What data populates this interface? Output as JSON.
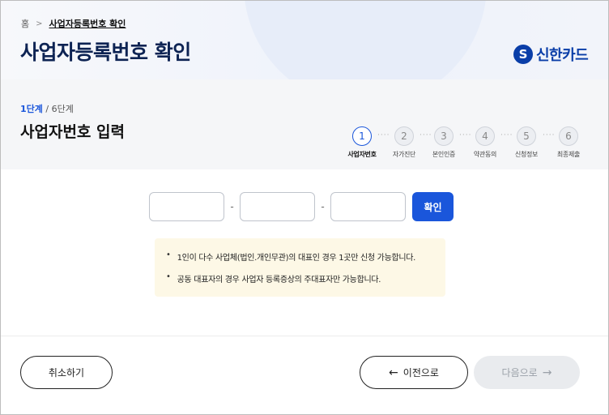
{
  "breadcrumb": {
    "home": "홈",
    "current": "사업자등록번호 확인"
  },
  "page_title": "사업자등록번호 확인",
  "brand": {
    "logo_glyph": "S",
    "name": "신한카드",
    "color": "#0a3ea8"
  },
  "step_count": {
    "current": "1단계",
    "total": " / 6단계"
  },
  "step_heading": "사업자번호 입력",
  "steps": [
    {
      "num": "1",
      "label": "사업자번호",
      "active": true
    },
    {
      "num": "2",
      "label": "자가진단",
      "active": false
    },
    {
      "num": "3",
      "label": "본인인증",
      "active": false
    },
    {
      "num": "4",
      "label": "약관동의",
      "active": false
    },
    {
      "num": "5",
      "label": "신청정보",
      "active": false
    },
    {
      "num": "6",
      "label": "최종제출",
      "active": false
    }
  ],
  "step_dots": "····",
  "business_number": {
    "part1": "",
    "part2": "",
    "part3": "",
    "dash": "-",
    "confirm_label": "확인"
  },
  "notice": [
    "1인이 다수 사업체(법인.개인무관)의 대표인 경우 1곳만 신청 가능합니다.",
    "공동 대표자의 경우 사업자 등록증상의 주대표자만 가능합니다."
  ],
  "notice_bullet": "•",
  "footer": {
    "cancel_label": "취소하기",
    "prev_label": "이전으로",
    "prev_arrow": "←",
    "next_label": "다음으로",
    "next_arrow": "→"
  },
  "colors": {
    "accent": "#1a56db",
    "notice_bg": "#fdf8e6",
    "disabled_bg": "#e9ebee"
  }
}
